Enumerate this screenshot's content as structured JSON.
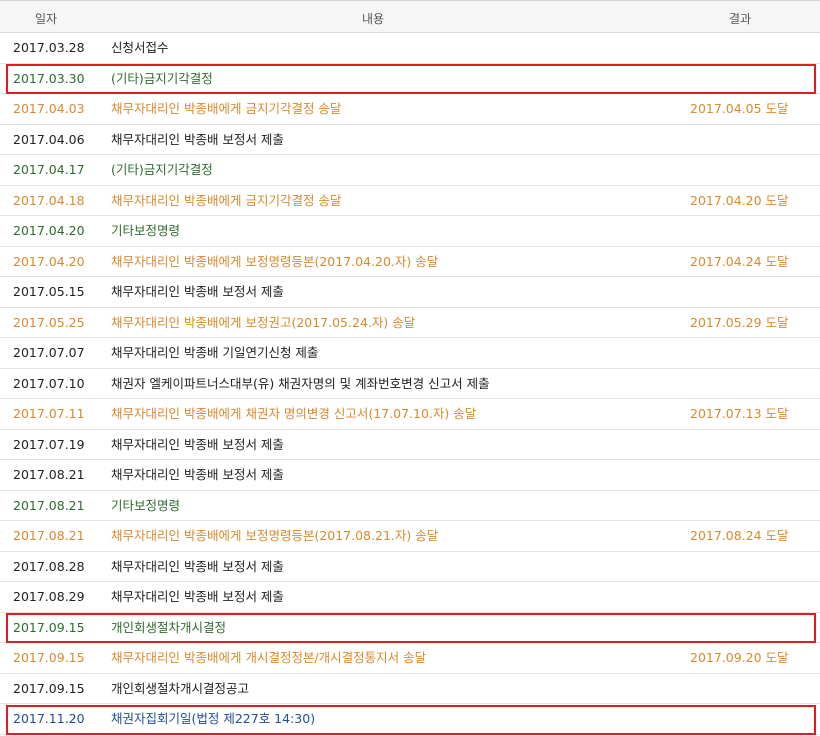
{
  "header": {
    "date": "일자",
    "content": "내용",
    "result": "결과"
  },
  "colors": {
    "black": "#222222",
    "orange": "#d98a2e",
    "green": "#2f6b2f",
    "blue": "#1f4e96",
    "highlight": "#e01b24"
  },
  "rows": [
    {
      "date": "2017.03.28",
      "content": "신청서접수",
      "result": "",
      "color": "black",
      "highlighted": false
    },
    {
      "date": "2017.03.30",
      "content": "(기타)금지기각결정",
      "result": "",
      "color": "green",
      "highlighted": true
    },
    {
      "date": "2017.04.03",
      "content": "채무자대리인 박종배에게 금지기각결정 송달",
      "result": "2017.04.05 도달",
      "color": "orange",
      "highlighted": false
    },
    {
      "date": "2017.04.06",
      "content": "채무자대리인 박종배 보정서 제출",
      "result": "",
      "color": "black",
      "highlighted": false
    },
    {
      "date": "2017.04.17",
      "content": "(기타)금지기각결정",
      "result": "",
      "color": "green",
      "highlighted": false
    },
    {
      "date": "2017.04.18",
      "content": "채무자대리인 박종배에게 금지기각결정 송달",
      "result": "2017.04.20 도달",
      "color": "orange",
      "highlighted": false
    },
    {
      "date": "2017.04.20",
      "content": "기타보정명령",
      "result": "",
      "color": "green",
      "highlighted": false
    },
    {
      "date": "2017.04.20",
      "content": "채무자대리인 박종배에게 보정명령등본(2017.04.20.자) 송달",
      "result": "2017.04.24 도달",
      "color": "orange",
      "highlighted": false
    },
    {
      "date": "2017.05.15",
      "content": "채무자대리인 박종배 보정서 제출",
      "result": "",
      "color": "black",
      "highlighted": false
    },
    {
      "date": "2017.05.25",
      "content": "채무자대리인 박종배에게 보정권고(2017.05.24.자) 송달",
      "result": "2017.05.29 도달",
      "color": "orange",
      "highlighted": false
    },
    {
      "date": "2017.07.07",
      "content": "채무자대리인 박종배 기일연기신청 제출",
      "result": "",
      "color": "black",
      "highlighted": false
    },
    {
      "date": "2017.07.10",
      "content": "채권자 엘케이파트너스대부(유) 채권자명의 및 계좌번호변경 신고서 제출",
      "result": "",
      "color": "black",
      "highlighted": false
    },
    {
      "date": "2017.07.11",
      "content": "채무자대리인 박종배에게 채권자 명의변경 신고서(17.07.10.자) 송달",
      "result": "2017.07.13 도달",
      "color": "orange",
      "highlighted": false
    },
    {
      "date": "2017.07.19",
      "content": "채무자대리인 박종배 보정서 제출",
      "result": "",
      "color": "black",
      "highlighted": false
    },
    {
      "date": "2017.08.21",
      "content": "채무자대리인 박종배 보정서 제출",
      "result": "",
      "color": "black",
      "highlighted": false
    },
    {
      "date": "2017.08.21",
      "content": "기타보정명령",
      "result": "",
      "color": "green",
      "highlighted": false
    },
    {
      "date": "2017.08.21",
      "content": "채무자대리인 박종배에게 보정명령등본(2017.08.21.자) 송달",
      "result": "2017.08.24 도달",
      "color": "orange",
      "highlighted": false
    },
    {
      "date": "2017.08.28",
      "content": "채무자대리인 박종배 보정서 제출",
      "result": "",
      "color": "black",
      "highlighted": false
    },
    {
      "date": "2017.08.29",
      "content": "채무자대리인 박종배 보정서 제출",
      "result": "",
      "color": "black",
      "highlighted": false
    },
    {
      "date": "2017.09.15",
      "content": "개인회생절차개시결정",
      "result": "",
      "color": "green",
      "highlighted": true
    },
    {
      "date": "2017.09.15",
      "content": "채무자대리인 박종배에게 개시결정정본/개시결정통지서 송달",
      "result": "2017.09.20 도달",
      "color": "orange",
      "highlighted": false
    },
    {
      "date": "2017.09.15",
      "content": "개인회생절차개시결정공고",
      "result": "",
      "color": "black",
      "highlighted": false
    },
    {
      "date": "2017.11.20",
      "content": "채권자집회기일(법정 제227호 14:30)",
      "result": "",
      "color": "blue",
      "highlighted": true
    }
  ]
}
